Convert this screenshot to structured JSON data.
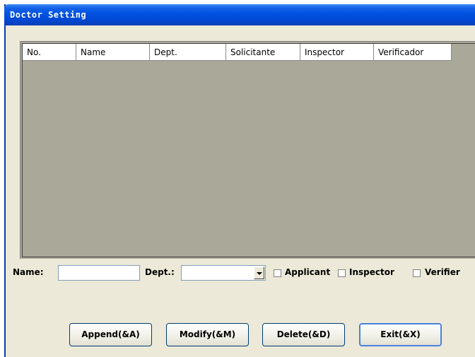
{
  "window": {
    "title": "Doctor Setting"
  },
  "table": {
    "columns": [
      "No.",
      "Name",
      "Dept.",
      "Solicitante",
      "Inspector",
      "Verificador"
    ]
  },
  "form": {
    "name_label": "Name:",
    "name_value": "",
    "dept_label": "Dept.:",
    "dept_value": "",
    "applicant_label": "Applicant",
    "inspector_label": "Inspector",
    "verifier_label": "Verifier"
  },
  "buttons": {
    "append": "Append(&A)",
    "modify": "Modify(&M)",
    "delete": "Delete(&D)",
    "exit": "Exit(&X)"
  },
  "colors": {
    "titlebar": "#0052e0",
    "grid_bg": "#aaa898",
    "window_bg": "#ece9d8"
  }
}
